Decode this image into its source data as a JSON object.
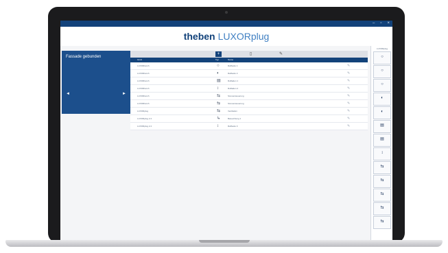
{
  "app": {
    "brand_logo": "theben",
    "brand_product": "LUXORplug",
    "window_controls": [
      "–",
      "▫",
      "×"
    ]
  },
  "side_panel": {
    "title": "Fassade gebunden",
    "nav_prev": "◄",
    "nav_next": "►"
  },
  "toolbar": {
    "add_icon": "+",
    "doc_icon": "▯",
    "edit_icon": "✎"
  },
  "table": {
    "headers": [
      "Gruß",
      "Typ",
      "Name"
    ],
    "rows": [
      {
        "name": "LUXORlunch",
        "icon": "○",
        "desc": "Raffsetto 1",
        "action": "✎"
      },
      {
        "name": "LUXORlunch",
        "icon": "◐",
        "desc": "Raffsetto 2",
        "action": "✎"
      },
      {
        "name": "LUXORlunch",
        "icon": "▤",
        "desc": "Rollladen 1",
        "action": "✎"
      },
      {
        "name": "LUXORlunch",
        "icon": "↕",
        "desc": "Rollladen 2",
        "action": "✎"
      },
      {
        "name": "LUXORlunch",
        "icon": "⇆",
        "desc": "Szenensteuerung",
        "action": "✎"
      },
      {
        "name": "LUXORlunch",
        "icon": "⇆",
        "desc": "Szenensteuerung",
        "action": "✎"
      },
      {
        "name": "LUXORplug",
        "icon": "⇆",
        "desc": "Ventilation",
        "action": "✎"
      },
      {
        "name": "LUXORplug 2.4",
        "icon": "↳",
        "desc": "Beleuchtung 1",
        "action": "✎"
      },
      {
        "name": "LUXORplug 2.4",
        "icon": "↕",
        "desc": "Raffsetto 3",
        "action": "✎"
      }
    ]
  },
  "right_panel": {
    "header": "LUXORplug",
    "tiles": [
      "○",
      "○",
      "○",
      "◐",
      "◐",
      "▤",
      "▤",
      "↕",
      "⇆",
      "⇆",
      "⇆",
      "⇆",
      "⇆"
    ]
  }
}
